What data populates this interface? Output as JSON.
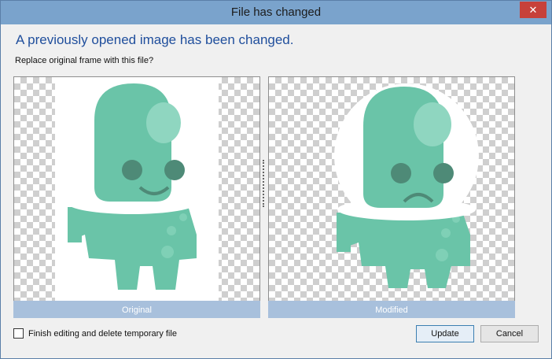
{
  "window": {
    "title": "File has changed",
    "close_glyph": "✕"
  },
  "dialog": {
    "heading": "A previously opened image has been changed.",
    "question": "Replace original frame with this file?"
  },
  "panels": {
    "original_label": "Original",
    "modified_label": "Modified"
  },
  "options": {
    "delete_temp_label": "Finish editing and delete temporary file",
    "delete_temp_checked": false
  },
  "buttons": {
    "update": "Update",
    "cancel": "Cancel"
  },
  "colors": {
    "alien": "#6ac4a8",
    "alien_shade": "#5aa88f",
    "eye": "#4e8a77",
    "caption_bar": "#a8c0dc",
    "title_bar": "#7aa3cc",
    "heading_text": "#1f4e9c"
  }
}
